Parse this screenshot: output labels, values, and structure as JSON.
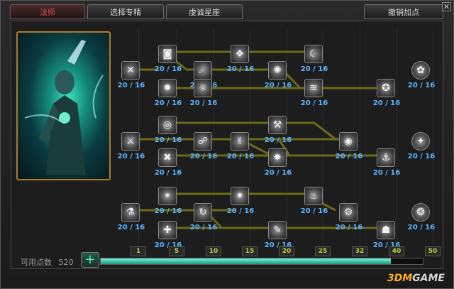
{
  "tabs": {
    "class_tab": "法师",
    "spec_tab": "选择专精",
    "constellation_tab": "虔诚星座",
    "reset_tab": "撤销加点"
  },
  "close_glyph": "✕",
  "skill_value": "20 / 16",
  "available_points_label": "可用点数",
  "available_points": "520",
  "progress": 0.9,
  "tiers": [
    "1",
    "5",
    "10",
    "15",
    "20",
    "25",
    "32",
    "40",
    "50"
  ],
  "watermark": {
    "prefix": "3DM",
    "suffix": "GAME"
  },
  "colors": {
    "accent_red": "#e05050",
    "value_blue": "#5ab4ff",
    "tier_green": "#b8d040",
    "bar_teal": "#1a9a80",
    "gold_frame": "#b07a2a"
  }
}
